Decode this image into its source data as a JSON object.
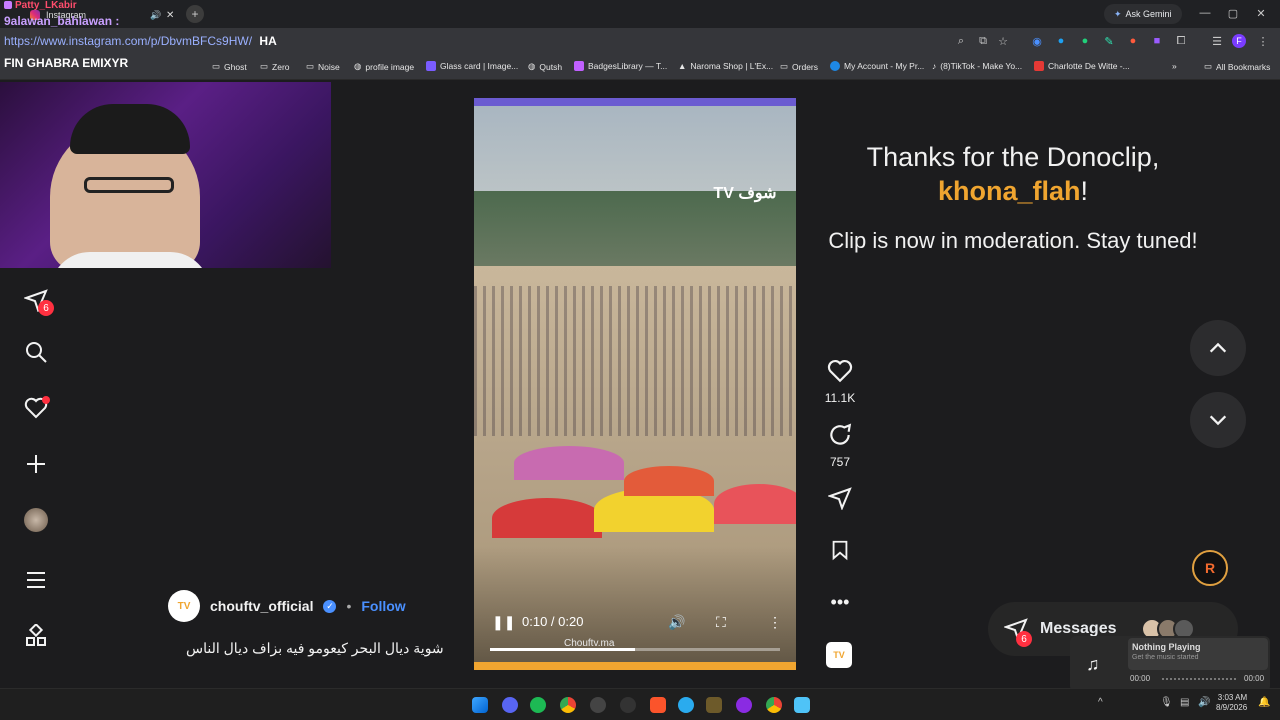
{
  "browser": {
    "tabs": [
      {
        "label": "Patty_LKabir"
      },
      {
        "label": "Instagram"
      }
    ],
    "url": "https://www.instagram.com/p/DbvmBFCs9HW/",
    "ask_gemini": "Ask Gemini",
    "bookmarks": [
      "Ghost",
      "Zero",
      "Noise",
      "profile image",
      "Glass card | Image...",
      "Qutsh",
      "BadgesLibrary — T...",
      "Naroma Shop | L'Ex...",
      "Orders",
      "My Account - My Pr...",
      "(8)TikTok - Make Yo...",
      "Charlotte De Witte -..."
    ],
    "all_bookmarks": "All Bookmarks"
  },
  "stream_overlay": {
    "chat_line_1": "9alawan_bahlawan :",
    "chat_line_1_suffix": "HA",
    "chat_line_2": "FIN GHABRA EMIXYR"
  },
  "sidebar": {
    "notifications_badge": "6"
  },
  "post": {
    "username": "chouftv_official",
    "follow_label": "Follow",
    "caption": "شوية ديال البحر كيعومو فيه بزاف ديال الناس",
    "likes": "11.1K",
    "comments": "757",
    "video_time": "0:10 / 0:20",
    "watermark": "Chouftv.ma",
    "logo_text": "شوف TV"
  },
  "donoclip": {
    "line1": "Thanks for the Donoclip,",
    "name": "khona_flah",
    "exclaim": "!",
    "line2": "Clip is now in moderation. Stay tuned!"
  },
  "messages": {
    "label": "Messages",
    "badge": "6"
  },
  "music_widget": {
    "title": "Nothing Playing",
    "subtitle": "Get the music started",
    "time_start": "00:00",
    "time_end": "00:00"
  },
  "taskbar": {
    "time": "3:03 AM",
    "date": "8/9/2026"
  },
  "colors": {
    "accent_orange": "#f0a530",
    "instagram_blue": "#4a90ff",
    "badge_red": "#ff3040"
  }
}
